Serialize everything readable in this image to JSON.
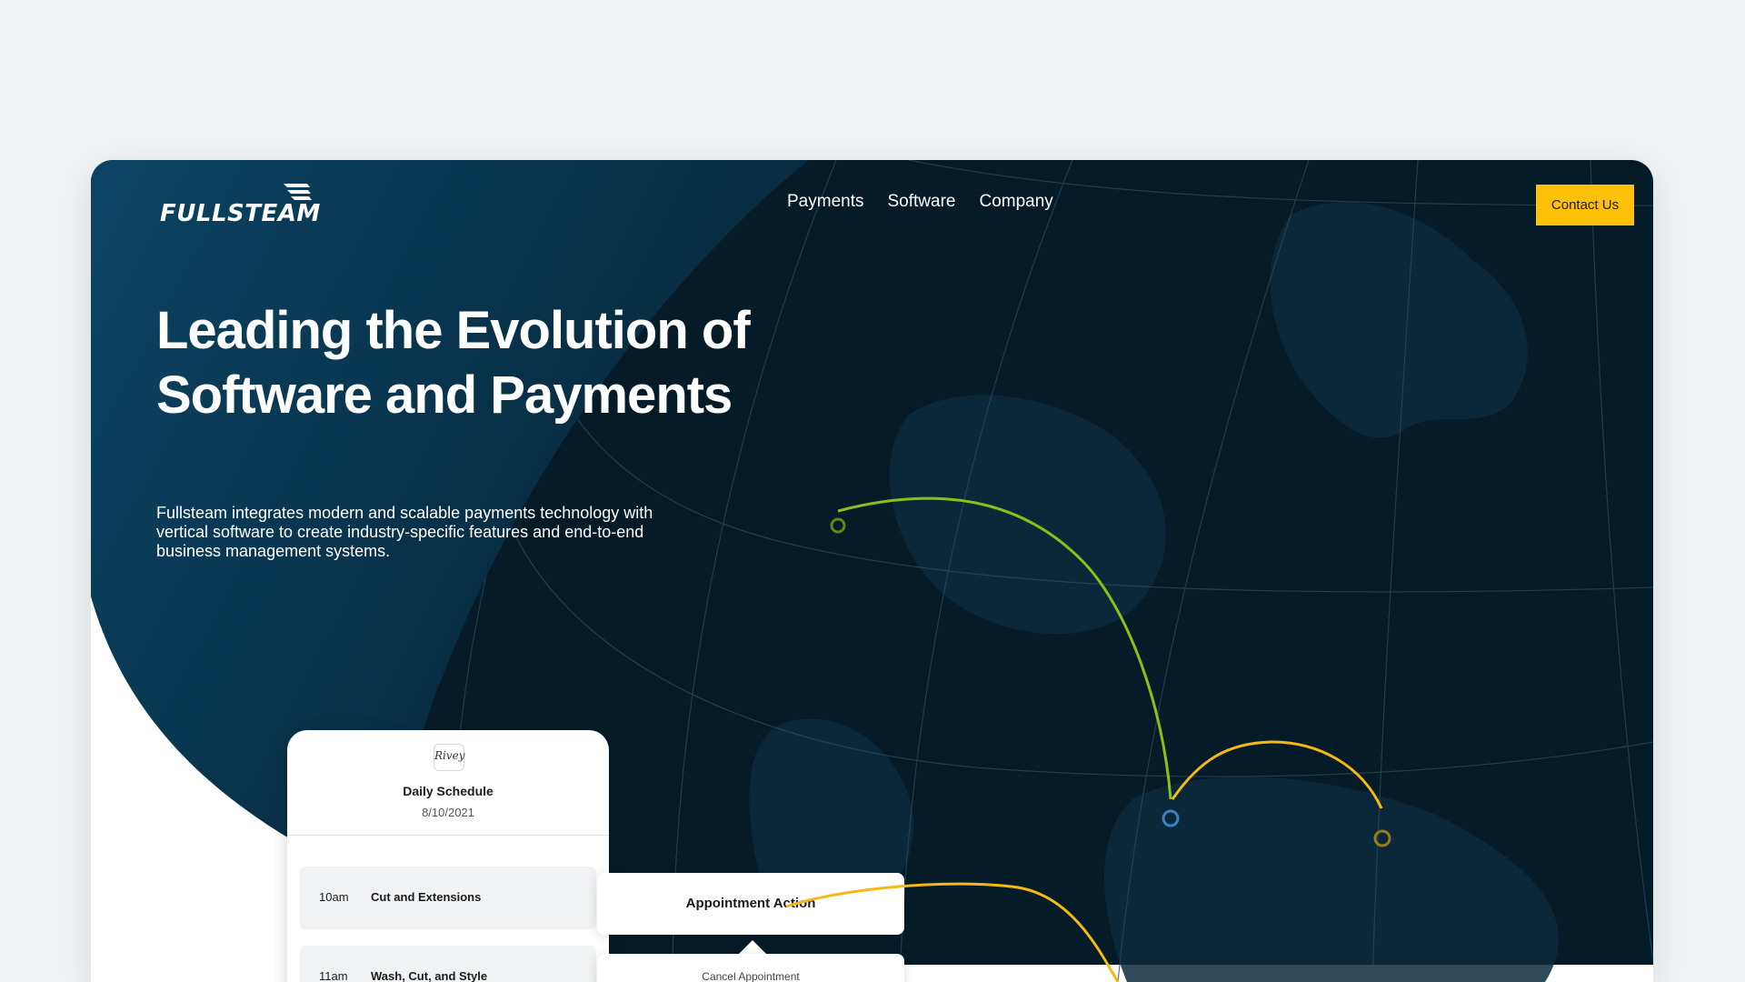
{
  "brand": {
    "logo_text": "FULLSTEAM"
  },
  "nav": {
    "items": [
      "Payments",
      "Software",
      "Company"
    ],
    "contact_label": "Contact Us"
  },
  "hero": {
    "headline": "Leading the Evolution of Software and Payments",
    "subtext": "Fullsteam integrates modern and scalable payments technology with vertical software to create industry-specific features and end-to-end business management systems."
  },
  "schedule_card": {
    "logo_text": "Rivey",
    "title": "Daily Schedule",
    "date": "8/10/2021",
    "rows": [
      {
        "time": "10am",
        "service": "Cut and Extensions"
      },
      {
        "time": "11am",
        "service": "Wash, Cut, and Style"
      }
    ]
  },
  "popups": {
    "action_label": "Appointment Action",
    "cancel_label": "Cancel Appointment"
  },
  "colors": {
    "accent": "#ffc107",
    "hero_bg": "#061b28",
    "hero_gradient": "#0b4564",
    "arc_green": "#8ac117",
    "arc_yellow": "#f5b914",
    "marker_blue": "#3e80c4"
  }
}
